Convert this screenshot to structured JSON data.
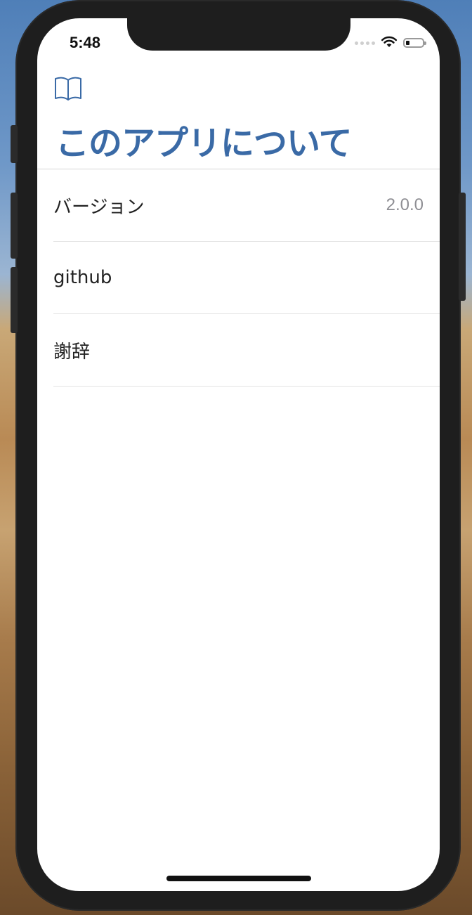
{
  "status_bar": {
    "time": "5:48",
    "wifi_icon": "wifi-icon",
    "battery_icon": "battery-icon"
  },
  "nav": {
    "icon": "book-icon",
    "title": "このアプリについて"
  },
  "rows": [
    {
      "label": "バージョン",
      "detail": "2.0.0"
    },
    {
      "label": "github",
      "detail": ""
    },
    {
      "label": "謝辞",
      "detail": ""
    }
  ],
  "colors": {
    "accent": "#3a6aa6"
  }
}
